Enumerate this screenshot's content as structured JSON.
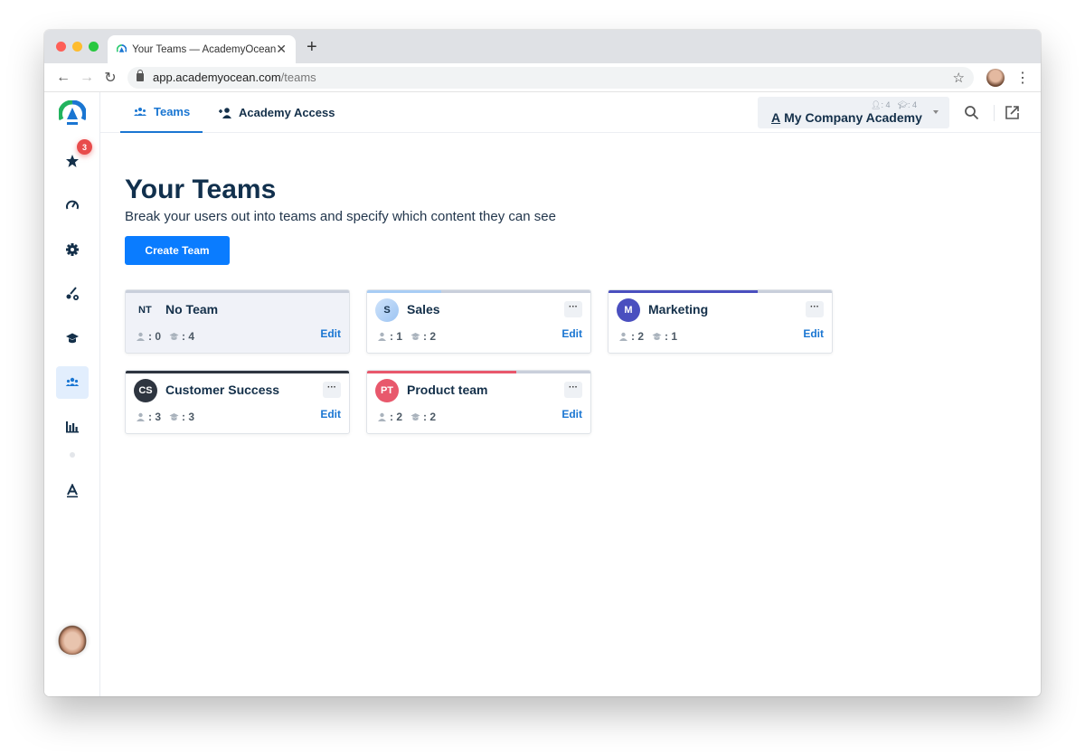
{
  "browser": {
    "tab_title": "Your Teams — AcademyOcean",
    "url_host": "app.academyocean.com",
    "url_path": "/teams"
  },
  "sidebar": {
    "notifications_badge": "3",
    "items": [
      {
        "name": "favorites",
        "icon": "star-icon"
      },
      {
        "name": "dashboard",
        "icon": "speedometer-icon"
      },
      {
        "name": "settings",
        "icon": "gear-icon"
      },
      {
        "name": "design",
        "icon": "brush-gear-icon"
      },
      {
        "name": "courses",
        "icon": "graduation-cap-icon"
      },
      {
        "name": "teams",
        "icon": "users-icon",
        "active": true
      },
      {
        "name": "reports",
        "icon": "bar-chart-icon"
      },
      {
        "name": "academy",
        "icon": "academy-a-icon"
      }
    ]
  },
  "topnav": {
    "tabs": [
      {
        "label": "Teams",
        "active": true
      },
      {
        "label": "Academy Access",
        "active": false
      }
    ],
    "academy": {
      "name": "My Company Academy",
      "mark": "A",
      "users_count": ": 4",
      "courses_count": ": 4"
    }
  },
  "page": {
    "title": "Your Teams",
    "subtitle": "Break your users out into teams and specify which content they can see",
    "create_button": "Create Team",
    "edit_label": "Edit",
    "more_label": "···"
  },
  "teams": [
    {
      "initials": "NT",
      "name": "No Team",
      "users": ": 0",
      "courses": ": 4",
      "color": "#c9cfdb",
      "progress": 1.0,
      "has_menu": false
    },
    {
      "initials": "S",
      "name": "Sales",
      "users": ": 1",
      "courses": ": 2",
      "color": "#a8cdf5",
      "progress": 0.33,
      "has_menu": true
    },
    {
      "initials": "M",
      "name": "Marketing",
      "users": ": 2",
      "courses": ": 1",
      "color": "#4a4fbf",
      "progress": 0.67,
      "has_menu": true
    },
    {
      "initials": "CS",
      "name": "Customer Success",
      "users": ": 3",
      "courses": ": 3",
      "color": "#2e3540",
      "progress": 1.0,
      "has_menu": true
    },
    {
      "initials": "PT",
      "name": "Product team",
      "users": ": 2",
      "courses": ": 2",
      "color": "#e8586c",
      "progress": 0.67,
      "has_menu": true
    }
  ]
}
